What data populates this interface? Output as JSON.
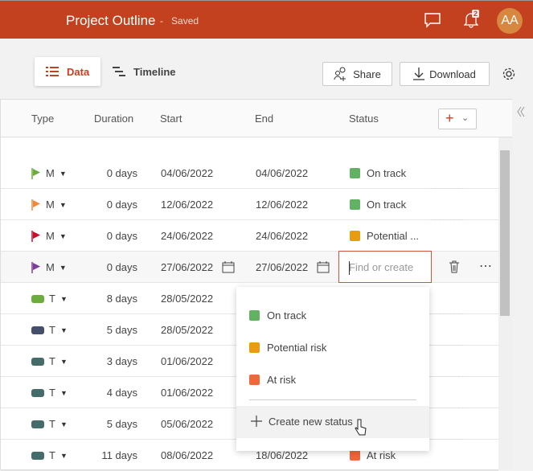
{
  "header": {
    "title": "Project Outline",
    "separator": "-",
    "save_state": "Saved",
    "notification_count": "2",
    "avatar_initials": "AA"
  },
  "toolbar": {
    "tabs": [
      {
        "label": "Data",
        "active": true
      },
      {
        "label": "Timeline",
        "active": false
      }
    ],
    "share_label": "Share",
    "download_label": "Download"
  },
  "table": {
    "columns": [
      "Type",
      "Duration",
      "Start",
      "End",
      "Status"
    ],
    "rows": [
      {
        "type": "M",
        "marker": "flag",
        "color": "#6aad3d",
        "duration": "0 days",
        "start": "04/06/2022",
        "end": "04/06/2022",
        "status": "On track",
        "status_color": "#63b264"
      },
      {
        "type": "M",
        "marker": "flag",
        "color": "#ef8a3a",
        "duration": "0 days",
        "start": "12/06/2022",
        "end": "12/06/2022",
        "status": "On track",
        "status_color": "#63b264"
      },
      {
        "type": "M",
        "marker": "flag",
        "color": "#c8102e",
        "duration": "0 days",
        "start": "24/06/2022",
        "end": "24/06/2022",
        "status": "Potential ...",
        "status_color": "#e89c0e"
      },
      {
        "type": "M",
        "marker": "flag",
        "color": "#7d3c98",
        "duration": "0 days",
        "start": "27/06/2022",
        "end": "27/06/2022",
        "status": "",
        "status_color": ""
      },
      {
        "type": "T",
        "marker": "pill",
        "color": "#6aad3d",
        "duration": "8 days",
        "start": "28/05/2022",
        "end": "",
        "status": "",
        "status_color": ""
      },
      {
        "type": "T",
        "marker": "pill",
        "color": "#454f6b",
        "duration": "5 days",
        "start": "28/05/2022",
        "end": "",
        "status": "",
        "status_color": ""
      },
      {
        "type": "T",
        "marker": "pill",
        "color": "#456b6b",
        "duration": "3 days",
        "start": "01/06/2022",
        "end": "",
        "status": "",
        "status_color": ""
      },
      {
        "type": "T",
        "marker": "pill",
        "color": "#456b6b",
        "duration": "4 days",
        "start": "01/06/2022",
        "end": "",
        "status": "",
        "status_color": ""
      },
      {
        "type": "T",
        "marker": "pill",
        "color": "#456b6b",
        "duration": "5 days",
        "start": "05/06/2022",
        "end": "",
        "status": "",
        "status_color": ""
      },
      {
        "type": "T",
        "marker": "pill",
        "color": "#456b6b",
        "duration": "11 days",
        "start": "08/06/2022",
        "end": "18/06/2022",
        "status": "At risk",
        "status_color": "#f0673a"
      }
    ]
  },
  "status_editor": {
    "placeholder": "Find or create"
  },
  "status_dropdown": {
    "options": [
      {
        "label": "On track",
        "color": "#63b264"
      },
      {
        "label": "Potential risk",
        "color": "#e89c0e"
      },
      {
        "label": "At risk",
        "color": "#f0673a"
      }
    ],
    "create_label": "Create new status"
  }
}
